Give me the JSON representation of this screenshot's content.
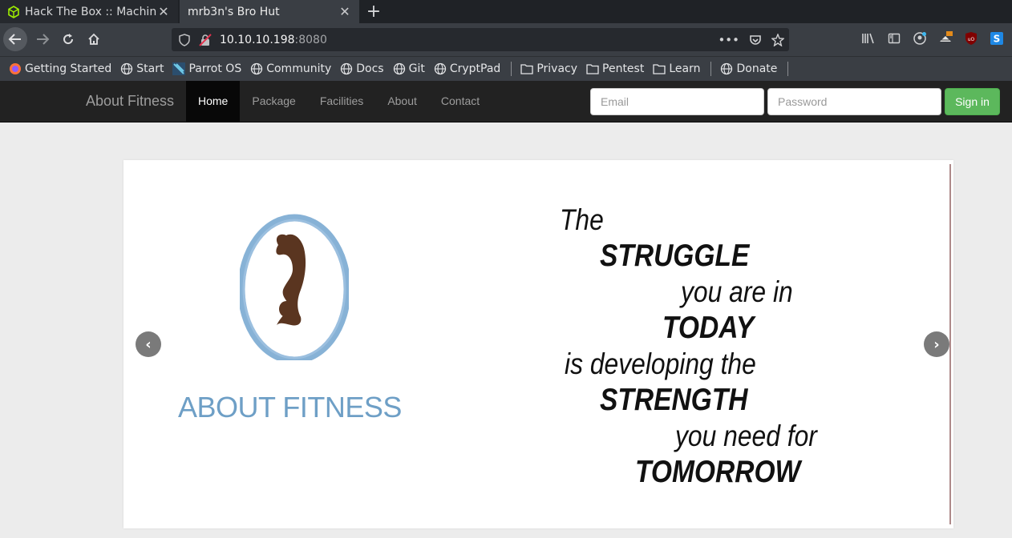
{
  "browser": {
    "tabs": [
      {
        "title": "Hack The Box :: Machines",
        "active": false
      },
      {
        "title": "mrb3n's Bro Hut",
        "active": true
      }
    ],
    "url": {
      "host": "10.10.10.198",
      "port": ":8080"
    },
    "bookmarks": [
      {
        "label": "Getting Started",
        "icon": "firefox-icon"
      },
      {
        "label": "Start",
        "icon": "globe-icon"
      },
      {
        "label": "Parrot OS",
        "icon": "parrot-icon"
      },
      {
        "label": "Community",
        "icon": "globe-icon"
      },
      {
        "label": "Docs",
        "icon": "globe-icon"
      },
      {
        "label": "Git",
        "icon": "globe-icon"
      },
      {
        "label": "CryptPad",
        "icon": "globe-icon"
      },
      {
        "label": "Privacy",
        "icon": "folder-icon"
      },
      {
        "label": "Pentest",
        "icon": "folder-icon"
      },
      {
        "label": "Learn",
        "icon": "folder-icon"
      },
      {
        "label": "Donate",
        "icon": "globe-icon"
      }
    ]
  },
  "site": {
    "brand": "About Fitness",
    "menu": [
      "Home",
      "Package",
      "Facilities",
      "About",
      "Contact"
    ],
    "active_menu": "Home",
    "email_placeholder": "Email",
    "password_placeholder": "Password",
    "signin_label": "Sign in"
  },
  "slide": {
    "logo_text": "ABOUT FITNESS",
    "quote": [
      "The",
      "STRUGGLE",
      "you are in",
      "TODAY",
      "is developing the",
      "STRENGTH",
      "you need for",
      "TOMORROW"
    ]
  },
  "colors": {
    "navbar": "#222222",
    "signin": "#5cb85c",
    "logo_blue": "#6e9fc6",
    "figure_brown": "#5a3520"
  }
}
